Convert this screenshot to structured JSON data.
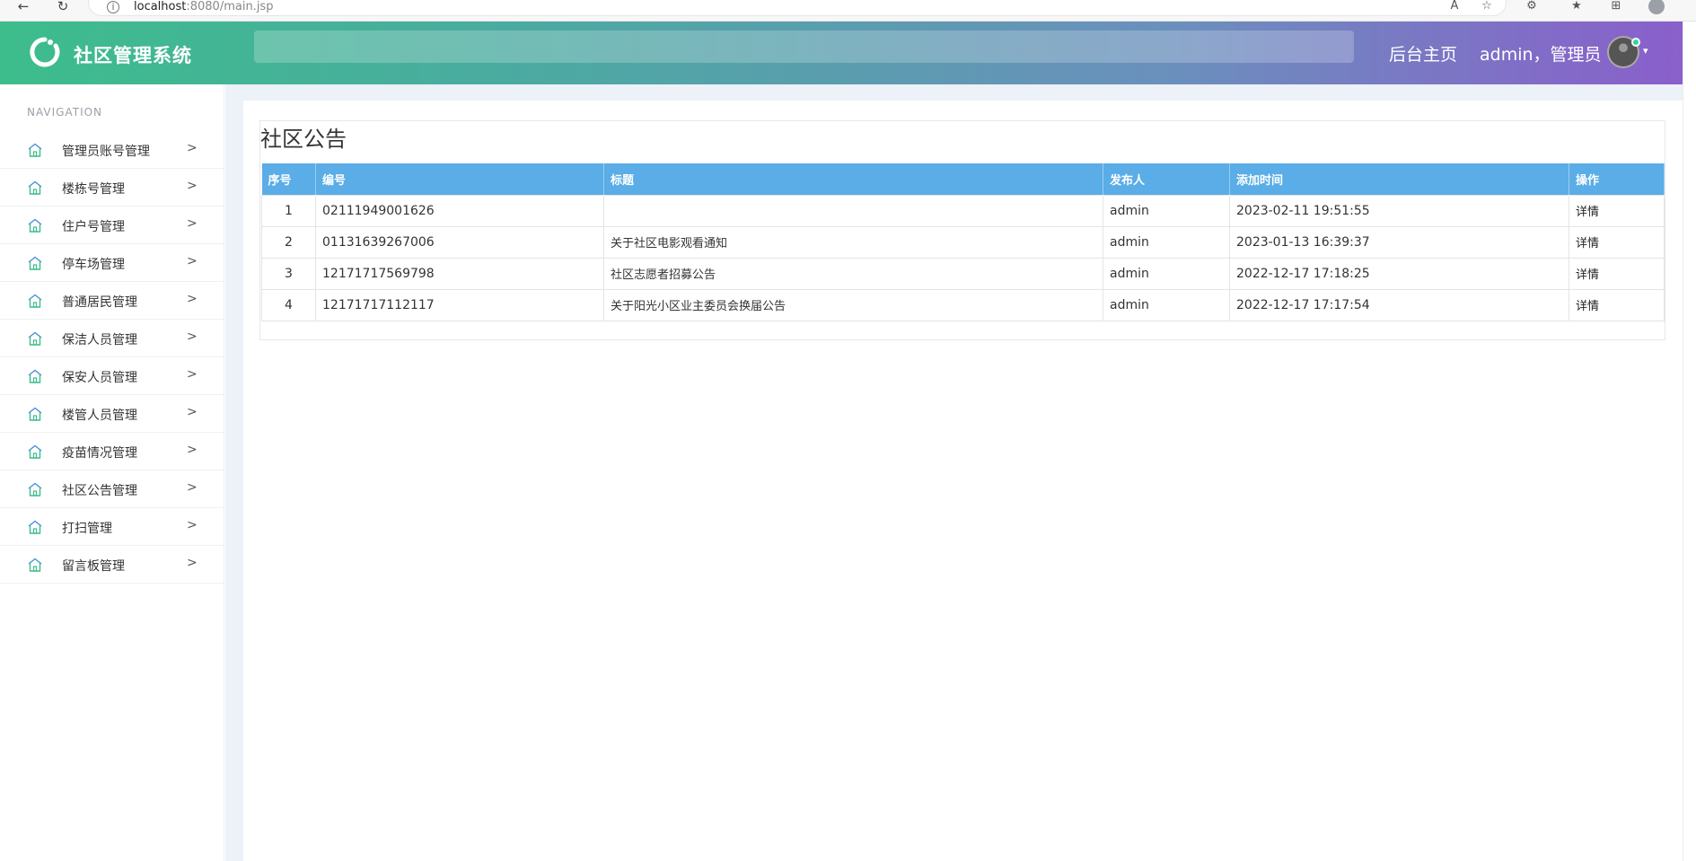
{
  "browser": {
    "url_host": "localhost",
    "url_rest": ":8080/main.jsp",
    "icons": [
      "back-icon",
      "reload-icon",
      "info-icon",
      "read-aloud-icon",
      "favorites-add-icon",
      "extensions-icon",
      "favorites-icon",
      "collections-icon",
      "profile-icon"
    ]
  },
  "header": {
    "title": "社区管理系统",
    "home_link": "后台主页",
    "user": "admin，管理员",
    "colors": {
      "start": "#3dbd8c",
      "end": "#8a5fcb"
    }
  },
  "sidebar": {
    "heading": "NAVIGATION",
    "items": [
      {
        "label": "管理员账号管理"
      },
      {
        "label": "楼栋号管理"
      },
      {
        "label": "住户号管理"
      },
      {
        "label": "停车场管理"
      },
      {
        "label": "普通居民管理"
      },
      {
        "label": "保洁人员管理"
      },
      {
        "label": "保安人员管理"
      },
      {
        "label": "楼管人员管理"
      },
      {
        "label": "疫苗情况管理"
      },
      {
        "label": "社区公告管理"
      },
      {
        "label": "打扫管理"
      },
      {
        "label": "留言板管理"
      }
    ]
  },
  "main": {
    "title": "社区公告",
    "columns": [
      "序号",
      "编号",
      "标题",
      "发布人",
      "添加时间",
      "操作"
    ],
    "rows": [
      {
        "index": "1",
        "code": "02111949001626",
        "title": "",
        "publisher": "admin",
        "time": "2023-02-11 19:51:55",
        "action": "详情"
      },
      {
        "index": "2",
        "code": "01131639267006",
        "title": "关于社区电影观看通知",
        "publisher": "admin",
        "time": "2023-01-13 16:39:37",
        "action": "详情"
      },
      {
        "index": "3",
        "code": "12171717569798",
        "title": "社区志愿者招募公告",
        "publisher": "admin",
        "time": "2022-12-17 17:18:25",
        "action": "详情"
      },
      {
        "index": "4",
        "code": "12171717112117",
        "title": "关于阳光小区业主委员会换届公告",
        "publisher": "admin",
        "time": "2022-12-17 17:17:54",
        "action": "详情"
      }
    ],
    "table_header_color": "#5aade6"
  }
}
